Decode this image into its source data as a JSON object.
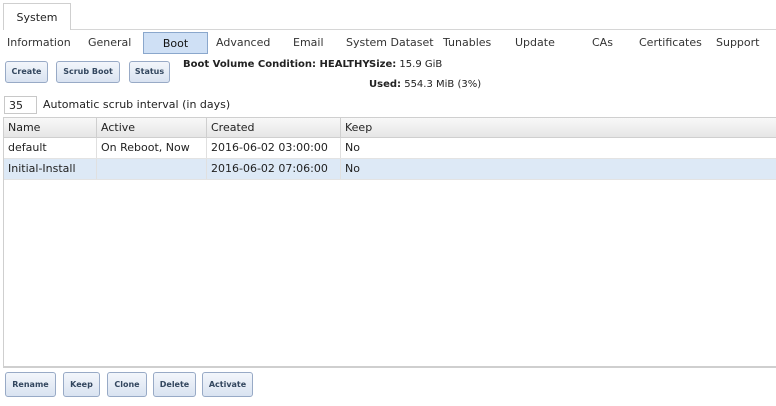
{
  "top_tab": {
    "label": "System"
  },
  "subtabs": [
    {
      "label": "Information"
    },
    {
      "label": "General"
    },
    {
      "label": "Boot",
      "active": true
    },
    {
      "label": "Advanced"
    },
    {
      "label": "Email"
    },
    {
      "label": "System Dataset"
    },
    {
      "label": "Tunables"
    },
    {
      "label": "Update"
    },
    {
      "label": "CAs"
    },
    {
      "label": "Certificates"
    },
    {
      "label": "Support"
    }
  ],
  "toolbar": {
    "create_label": "Create",
    "scrub_boot_label": "Scrub Boot",
    "status_label": "Status"
  },
  "boot_status": {
    "condition": "Boot Volume Condition: HEALTHY",
    "size_label": "Size:",
    "size_value": "15.9 GiB",
    "used_label": "Used:",
    "used_value": "554.3 MiB (3%)"
  },
  "scrub": {
    "interval_value": "35",
    "interval_label": "Automatic scrub interval (in days)"
  },
  "table": {
    "columns": [
      "Name",
      "Active",
      "Created",
      "Keep"
    ],
    "rows": [
      [
        "default",
        "On Reboot, Now",
        "2016-06-02 03:00:00",
        "No"
      ],
      [
        "Initial-Install",
        "",
        "2016-06-02 07:06:00",
        "No"
      ]
    ],
    "selected_row": 1
  },
  "actions": {
    "rename_label": "Rename",
    "keep_label": "Keep",
    "clone_label": "Clone",
    "delete_label": "Delete",
    "activate_label": "Activate"
  },
  "colors": {
    "accent": "#cfe0f5",
    "button_border": "#98aac6",
    "selected_row": "#dde9f6"
  }
}
